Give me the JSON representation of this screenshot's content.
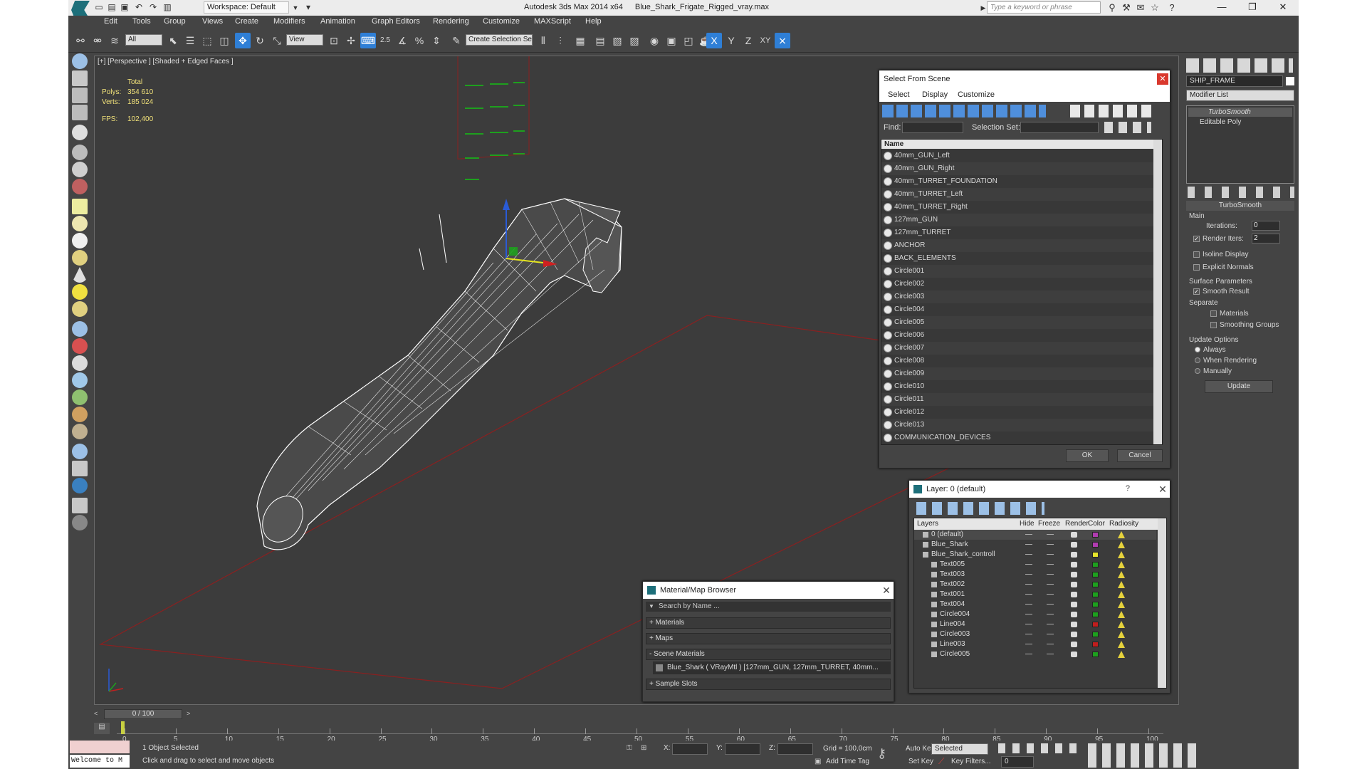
{
  "window": {
    "app_title": "Autodesk 3ds Max  2014 x64",
    "file_name": "Blue_Shark_Frigate_Rigged_vray.max",
    "workspace": "Workspace: Default",
    "search_placeholder": "Type a keyword or phrase"
  },
  "menu": [
    "Edit",
    "Tools",
    "Group",
    "Views",
    "Create",
    "Modifiers",
    "Animation",
    "Graph Editors",
    "Rendering",
    "Customize",
    "MAXScript",
    "Help"
  ],
  "toolbar": {
    "selection_filter": "All",
    "ref_coord": "View",
    "create_selection_set": "Create Selection Se",
    "snap_label": "2.5",
    "axis_x": "X",
    "axis_y": "Y",
    "axis_z": "Z",
    "axis_xy": "XY"
  },
  "viewport": {
    "label": "[+] [Perspective ] [Shaded + Edged Faces ]",
    "stats": {
      "total_label": "Total",
      "polys_label": "Polys:",
      "polys_value": "354 610",
      "verts_label": "Verts:",
      "verts_value": "185 024",
      "fps_label": "FPS:",
      "fps_value": "102,400"
    }
  },
  "select_from_scene": {
    "title": "Select From Scene",
    "menus": [
      "Select",
      "Display",
      "Customize"
    ],
    "find_label": "Find:",
    "selection_set_label": "Selection Set:",
    "column_name": "Name",
    "items": [
      "40mm_GUN_Left",
      "40mm_GUN_Right",
      "40mm_TURRET_FOUNDATION",
      "40mm_TURRET_Left",
      "40mm_TURRET_Right",
      "127mm_GUN",
      "127mm_TURRET",
      "ANCHOR",
      "BACK_ELEMENTS",
      "Circle001",
      "Circle002",
      "Circle003",
      "Circle004",
      "Circle005",
      "Circle006",
      "Circle007",
      "Circle008",
      "Circle009",
      "Circle010",
      "Circle011",
      "Circle012",
      "Circle013",
      "COMMUNICATION_DEVICES"
    ],
    "ok": "OK",
    "cancel": "Cancel"
  },
  "layer_dialog": {
    "title": "Layer: 0 (default)",
    "help": "?",
    "columns": [
      "Layers",
      "Hide",
      "Freeze",
      "Render",
      "Color",
      "Radiosity"
    ],
    "rows": [
      {
        "name": "0 (default)",
        "color": "#b03cb0"
      },
      {
        "name": "Blue_Shark",
        "color": "#b03cb0"
      },
      {
        "name": "Blue_Shark_controll",
        "color": "#e6e62c"
      },
      {
        "name": "Text005",
        "color": "#1ea01e"
      },
      {
        "name": "Text003",
        "color": "#1ea01e"
      },
      {
        "name": "Text002",
        "color": "#1ea01e"
      },
      {
        "name": "Text001",
        "color": "#1ea01e"
      },
      {
        "name": "Text004",
        "color": "#1ea01e"
      },
      {
        "name": "Circle004",
        "color": "#1ea01e"
      },
      {
        "name": "Line004",
        "color": "#c01e1e"
      },
      {
        "name": "Circle003",
        "color": "#1ea01e"
      },
      {
        "name": "Line003",
        "color": "#c01e1e"
      },
      {
        "name": "Circle005",
        "color": "#1ea01e"
      }
    ]
  },
  "material_browser": {
    "title": "Material/Map Browser",
    "search_placeholder": "Search by Name ...",
    "sections": [
      "+ Materials",
      "+ Maps",
      "- Scene Materials"
    ],
    "scene_material": "Blue_Shark  ( VRayMtl )  [127mm_GUN, 127mm_TURRET, 40mm...",
    "sample_slots": "+ Sample Slots"
  },
  "command_panel": {
    "object_name": "SHIP_FRAME",
    "modifier_list": "Modifier List",
    "stack": [
      "TurboSmooth",
      "Editable Poly"
    ],
    "rollout_title": "TurboSmooth",
    "main_label": "Main",
    "iterations_label": "Iterations:",
    "iterations_value": "0",
    "render_iters_label": "Render Iters:",
    "render_iters_value": "2",
    "isoline_display": "Isoline Display",
    "explicit_normals": "Explicit Normals",
    "surface_parameters": "Surface Parameters",
    "smooth_result": "Smooth Result",
    "separate_label": "Separate",
    "materials": "Materials",
    "smoothing_groups": "Smoothing Groups",
    "update_options": "Update Options",
    "always": "Always",
    "when_rendering": "When Rendering",
    "manually": "Manually",
    "update_button": "Update"
  },
  "timeline": {
    "frame_display": "0 / 100",
    "ticks": [
      "0",
      "5",
      "10",
      "15",
      "20",
      "25",
      "30",
      "35",
      "40",
      "45",
      "50",
      "55",
      "60",
      "65",
      "70",
      "75",
      "80",
      "85",
      "90",
      "95",
      "100"
    ]
  },
  "status": {
    "maxscript_listener": "Welcome to M",
    "selection_info": "1 Object Selected",
    "prompt": "Click and drag to select and move objects",
    "x_label": "X:",
    "y_label": "Y:",
    "z_label": "Z:",
    "grid": "Grid = 100,0cm",
    "add_time_tag": "Add Time Tag",
    "auto_key": "Auto Key",
    "auto_key_mode": "Selected",
    "set_key": "Set Key",
    "key_filters": "Key Filters...",
    "current_frame": "0"
  },
  "colors": {
    "ui_background": "#444444",
    "viewport_background": "#3c3c3c",
    "wireframe": "#ffffff",
    "stats_text": "#f2e27a",
    "active_tool": "#2f7fd6",
    "grid_line": "#8a2020",
    "close_red": "#d9382d"
  }
}
